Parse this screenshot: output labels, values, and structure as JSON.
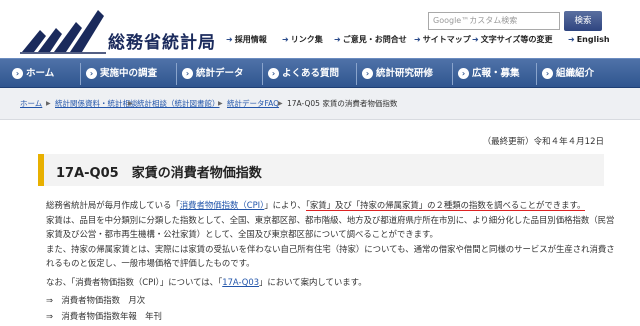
{
  "header": {
    "logo_text": "総務省統計局",
    "search_placeholder": "Google™カスタム検索",
    "search_button": "検索",
    "util_links": [
      "採用情報",
      "リンク集",
      "ご意見・お問合せ",
      "サイトマップ",
      "文字サイズ等の変更",
      "English"
    ]
  },
  "nav": {
    "items": [
      "ホーム",
      "実施中の調査",
      "統計データ",
      "よくある質問",
      "統計研究研修",
      "広報・募集",
      "組織紹介"
    ]
  },
  "breadcrumb": {
    "items": [
      "ホーム",
      "統計関係資料・統計相談",
      "統計相談（統計図書館）",
      "統計データFAQ"
    ],
    "current": "17A-Q05 家賃の消費者物価指数"
  },
  "main": {
    "updated": "（最終更新）令和４年４月12日",
    "title": "17A-Q05　家賃の消費者物価指数",
    "p1_a": "総務省統計局が毎月作成している「",
    "p1_link": "消費者物価指数（CPI）",
    "p1_b": "」により、",
    "p1_hl": "「家賃」及び「持家の帰属家賃」の２種類の指数を調べることができます。",
    "p2_l1": "家賃は、品目を中分類別に分類した指数として、全国、東京都区部、都市階級、地方及び都道府県庁所在市別に、より細分化した品目別価格指数（民営",
    "p2_l2": "家賃及び公営・都市再生機構・公社家賃）として、全国及び東京都区部について調べることができます。",
    "p3_l1": "また、持家の帰属家賃とは、実際には家賃の受払いを伴わない自己所有住宅（持家）についても、通常の借家や借間と同様のサービスが生産され消費さ",
    "p3_l2": "れるものと仮定し、一般市場価格で評価したものです。",
    "p4_a": "なお、「消費者物価指数（CPI）」については、「",
    "p4_link": "17A-Q03",
    "p4_b": "」において案内しています。",
    "refs": [
      "⇒　消費者物価指数　月次",
      "⇒　消費者物価指数年報　年刊"
    ]
  }
}
